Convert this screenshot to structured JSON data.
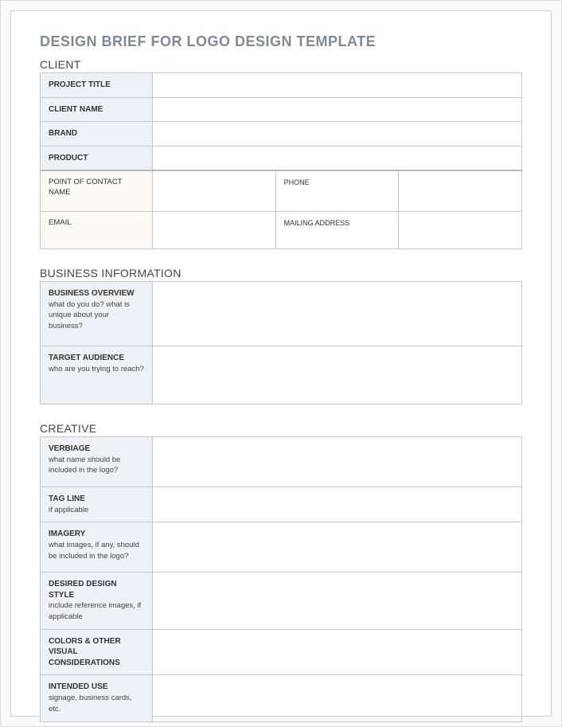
{
  "title": "DESIGN BRIEF FOR LOGO DESIGN TEMPLATE",
  "sections": {
    "client": {
      "header": "CLIENT",
      "rows": {
        "project_title": {
          "label": "PROJECT TITLE"
        },
        "client_name": {
          "label": "CLIENT NAME"
        },
        "brand": {
          "label": "BRAND"
        },
        "product": {
          "label": "PRODUCT"
        },
        "poc": {
          "label": "POINT OF CONTACT NAME",
          "phone_label": "PHONE"
        },
        "email": {
          "label": "EMAIL",
          "mailing_label": "MAILING ADDRESS"
        }
      }
    },
    "business": {
      "header": "BUSINESS INFORMATION",
      "rows": {
        "overview": {
          "label": "BUSINESS OVERVIEW",
          "desc": "what do you do? what is unique about your business?"
        },
        "audience": {
          "label": "TARGET AUDIENCE",
          "desc": "who are you trying to reach?"
        }
      }
    },
    "creative": {
      "header": "CREATIVE",
      "rows": {
        "verbiage": {
          "label": "VERBIAGE",
          "desc": "what name should be included in the logo?"
        },
        "tagline": {
          "label": "TAG LINE",
          "desc": "if applicable"
        },
        "imagery": {
          "label": "IMAGERY",
          "desc": "what images, if any, should be included in the logo?"
        },
        "style": {
          "label": "DESIRED DESIGN STYLE",
          "desc": "include reference images, if applicable"
        },
        "colors": {
          "label": "COLORS & OTHER VISUAL CONSIDERATIONS"
        },
        "use": {
          "label": "INTENDED USE",
          "desc": "signage, business cards, etc."
        }
      }
    }
  }
}
